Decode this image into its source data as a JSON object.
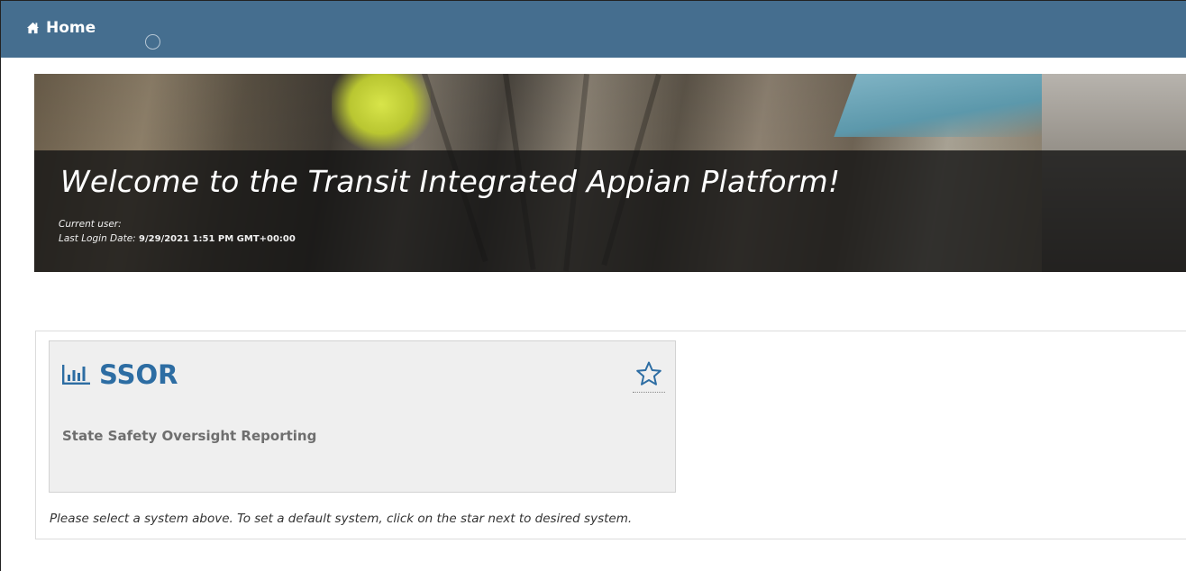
{
  "topbar": {
    "home_label": "Home",
    "home_icon": "home-icon",
    "background_color": "#456e8f"
  },
  "banner": {
    "welcome_text": "Welcome to the Transit Integrated Appian Platform!",
    "current_user_label": "Current user:",
    "last_login_label": "Last Login Date:",
    "last_login_value": "9/29/2021 1:51 PM GMT+00:00"
  },
  "systems": {
    "cards": [
      {
        "icon": "bar-chart-icon",
        "title": "SSOR",
        "subtitle": "State Safety Oversight Reporting",
        "favorite_icon": "star-outline-icon",
        "favorited": false
      }
    ],
    "hint": "Please select a system above. To set a default system, click on the star next to desired system."
  },
  "colors": {
    "accent": "#2d6da3",
    "card_background": "#efefef"
  }
}
